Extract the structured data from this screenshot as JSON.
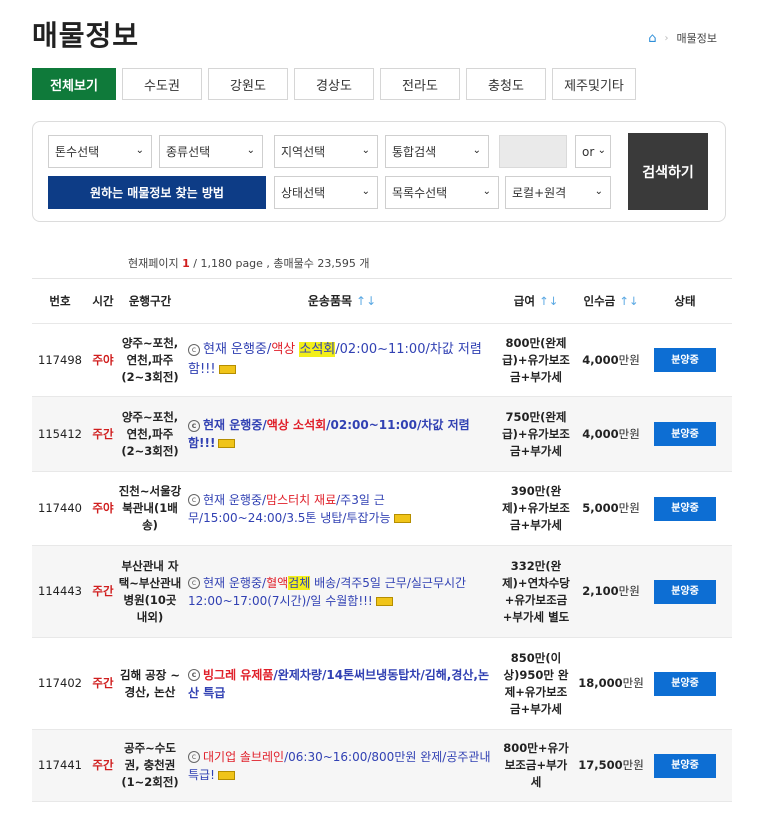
{
  "page_title": "매물정보",
  "breadcrumb": {
    "current": "매물정보"
  },
  "tabs": [
    "전체보기",
    "수도권",
    "강원도",
    "경상도",
    "전라도",
    "충청도",
    "제주및기타"
  ],
  "filters": {
    "tonnage": "톤수선택",
    "type": "종류선택",
    "region": "지역선택",
    "search_scope": "통합검색",
    "operator": "or",
    "status": "상태선택",
    "list_count": "목록수선택",
    "route_kind": "로컬+원격",
    "how_to_label": "원하는 매물정보 찾는 방법",
    "search_label": "검색하기"
  },
  "summary": {
    "prefix": "현재페이지",
    "current_page": "1",
    "rest": "/ 1,180 page , 총매물수 23,595 개"
  },
  "columns": {
    "no": "번호",
    "time": "시간",
    "route": "운행구간",
    "item": "운송품목",
    "pay": "급여",
    "deposit": "인수금",
    "status": "상태",
    "sort_arrows": "↑↓"
  },
  "icons": {
    "home": "home-icon",
    "circle_c": "copyright-circle-icon",
    "new": "new-badge-icon"
  },
  "colors": {
    "active_tab": "#0f7a3a",
    "how_to": "#0d3c86",
    "status_button": "#0d6ed3",
    "time_text": "#d01e1e"
  },
  "rows": [
    {
      "no": "117498",
      "time": "주야",
      "route": "양주~포천,연천,파주(2~3회전)",
      "item_a": "현재 운행중/",
      "item_red": "액상 ",
      "item_hl": "소석회",
      "item_b": "/02:00~11:00/차값 저렴함!!!",
      "pay": "800만(완제급)+유가보조금+부가세",
      "deposit": "4,000",
      "deposit_unit": "만원",
      "status": "분양중"
    },
    {
      "no": "115412",
      "time": "주간",
      "route": "양주~포천,연천,파주(2~3회전)",
      "item_a": "현재 운행중/",
      "item_red": "액상 소석회",
      "item_hl": "",
      "item_b": "/02:00~11:00/차값 저렴함!!!",
      "pay": "750만(완제급)+유가보조금+부가세",
      "deposit": "4,000",
      "deposit_unit": "만원",
      "status": "분양중"
    },
    {
      "no": "117440",
      "time": "주야",
      "route": "진천~서울강북관내(1배송)",
      "item_a": "현재 운행중/",
      "item_red": "맘스터치 재료",
      "item_hl": "",
      "item_b": "/주3일 근무/15:00~24:00/3.5톤 냉탑/투잡가능",
      "pay": "390만(완제)+유가보조금+부가세",
      "deposit": "5,000",
      "deposit_unit": "만원",
      "status": "분양중"
    },
    {
      "no": "114443",
      "time": "주간",
      "route": "부산관내 자택~부산관내 병원(10곳 내외)",
      "item_a": "현재 운행중/",
      "item_red": "혈액",
      "item_hl": "검체",
      "item_b": " 배송/격주5일 근무/실근무시간 12:00~17:00(7시간)/일 수월함!!!",
      "pay": "332만(완제)+연차수당+유가보조금+부가세 별도",
      "deposit": "2,100",
      "deposit_unit": "만원",
      "status": "분양중"
    },
    {
      "no": "117402",
      "time": "주간",
      "route": "김해 공장 ~ 경산, 논산",
      "item_a": "",
      "item_red": "빙그레 유제품",
      "item_hl": "",
      "item_b": "/완제차량/14톤써브냉동탑차/김해,경산,논산 특급",
      "pay": "850만(이상)950만 완제+유가보조금+부가세",
      "deposit": "18,000",
      "deposit_unit": "만원",
      "status": "분양중"
    },
    {
      "no": "117441",
      "time": "주간",
      "route": "공주~수도권, 충천권(1~2회전)",
      "item_a": "",
      "item_red": "대기업 솔브레인",
      "item_hl": "",
      "item_b": "/06:30~16:00/800만원 완제/공주관내 특급!",
      "pay": "800만+유가보조금+부가세",
      "deposit": "17,500",
      "deposit_unit": "만원",
      "status": "분양중"
    }
  ]
}
